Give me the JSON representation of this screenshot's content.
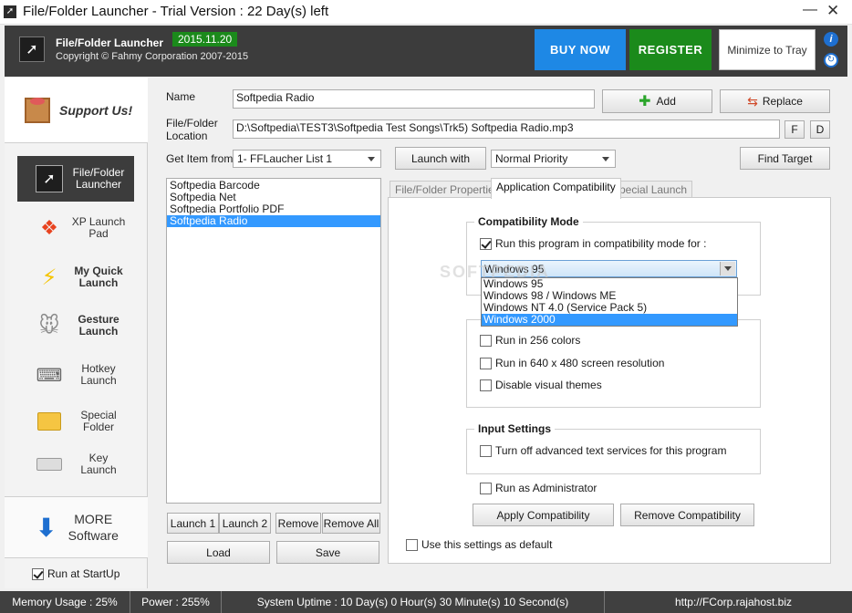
{
  "window": {
    "title": "File/Folder Launcher - Trial Version : 22 Day(s) left"
  },
  "header": {
    "app_name": "File/Folder Launcher",
    "version": "2015.11.20",
    "copyright": "Copyright © Fahmy Corporation 2007-2015",
    "buy_now": "BUY NOW",
    "register": "REGISTER",
    "minimize_tray": "Minimize to Tray"
  },
  "sidebar": {
    "support": "Support Us!",
    "items": [
      {
        "line1": "File/Folder",
        "line2": "Launcher"
      },
      {
        "line1": "XP Launch",
        "line2": "Pad"
      },
      {
        "line1": "My Quick",
        "line2": "Launch"
      },
      {
        "line1": "Gesture",
        "line2": "Launch"
      },
      {
        "line1": "Hotkey",
        "line2": "Launch"
      },
      {
        "line1": "Special",
        "line2": "Folder"
      },
      {
        "line1": "Key",
        "line2": "Launch"
      }
    ],
    "more_line1": "MORE",
    "more_line2": "Software",
    "run_startup": "Run at StartUp"
  },
  "form": {
    "name_label": "Name",
    "name_value": "Softpedia Radio",
    "location_label_1": "File/Folder",
    "location_label_2": "Location",
    "location_value": "D:\\Softpedia\\TEST3\\Softpedia Test Songs\\Trk5) Softpedia Radio.mp3",
    "f_button": "F",
    "d_button": "D",
    "add": "Add",
    "replace": "Replace",
    "get_item_label": "Get Item from",
    "get_item_value": "1- FFLaucher List 1",
    "launch_with": "Launch with",
    "priority_value": "Normal Priority",
    "find_target": "Find Target"
  },
  "list": {
    "items": [
      "Softpedia Barcode",
      "Softpedia Net",
      "Softpedia Portfolio PDF",
      "Softpedia Radio"
    ],
    "selected_index": 3,
    "launch1": "Launch 1",
    "launch2": "Launch 2",
    "remove": "Remove",
    "remove_all": "Remove All",
    "load": "Load",
    "save": "Save"
  },
  "tabs": {
    "properties": "File/Folder Properties",
    "compatibility": "Application Compatibility",
    "special": "Special Launch"
  },
  "compat": {
    "mode_title": "Compatibility Mode",
    "run_compat": "Run this program in compatibility mode for :",
    "os_selected": "Windows 95",
    "os_options": [
      "Windows 95",
      "Windows 98 / Windows ME",
      "Windows NT 4.0 (Service Pack 5)",
      "Windows 2000"
    ],
    "os_highlighted_index": 3,
    "colors_256": "Run in 256 colors",
    "res_640": "Run in 640 x 480 screen resolution",
    "disable_themes": "Disable visual themes",
    "input_title": "Input Settings",
    "turn_off_text": "Turn off advanced text services for this program",
    "run_admin": "Run as Administrator",
    "apply": "Apply Compatibility",
    "remove": "Remove Compatibility",
    "use_default": "Use this settings as default"
  },
  "status": {
    "memory": "Memory Usage : 25%",
    "power": "Power : 255%",
    "uptime": "System Uptime : 10 Day(s) 0 Hour(s) 30 Minute(s) 10 Second(s)",
    "url": "http://FCorp.rajahost.biz"
  },
  "watermark": "SOFTPEDIA",
  "colors": {
    "header_bg": "#3c3c3c",
    "buy_blue": "#1e88e5",
    "register_green": "#1b8a1b",
    "selection": "#3399ff",
    "status_bg": "#404040"
  }
}
